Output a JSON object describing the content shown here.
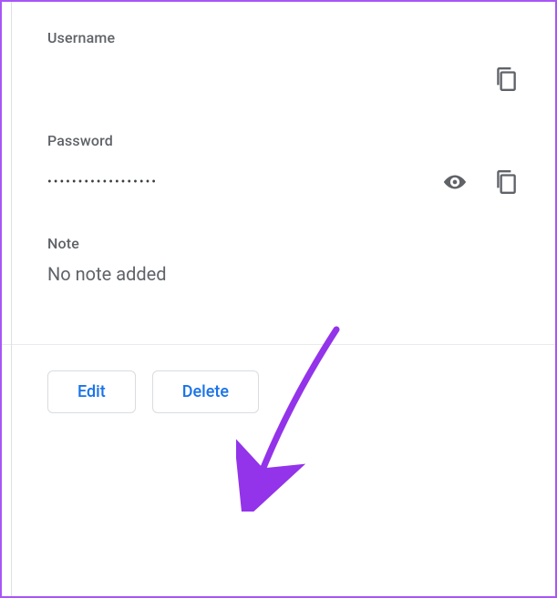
{
  "username": {
    "label": "Username",
    "value": ""
  },
  "password": {
    "label": "Password",
    "value_masked": "••••••••••••••••••"
  },
  "note": {
    "label": "Note",
    "placeholder": "No note added"
  },
  "buttons": {
    "edit": "Edit",
    "delete": "Delete"
  },
  "colors": {
    "accent_border": "#a855f7",
    "annotation_arrow": "#9333ea",
    "button_text": "#1a73e8",
    "label_text": "#5f6368"
  }
}
